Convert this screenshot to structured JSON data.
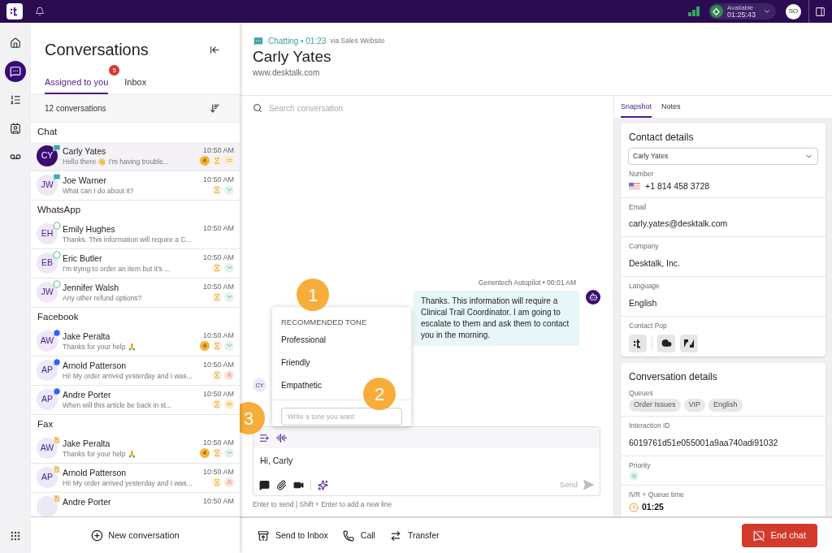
{
  "top_bar": {
    "status_label": "Available",
    "status_timer": "01:25:43",
    "user_initials": "SO"
  },
  "nav_rail": [
    {
      "kind": "home",
      "selected": false
    },
    {
      "kind": "conversations",
      "selected": true
    },
    {
      "kind": "tasks",
      "selected": false
    },
    {
      "kind": "contacts",
      "selected": false
    },
    {
      "kind": "voicemail",
      "selected": false
    }
  ],
  "conversations_panel": {
    "title": "Conversations",
    "tabs": [
      {
        "label": "Assigned to you",
        "badge": "5",
        "selected": true
      },
      {
        "label": "Inbox",
        "selected": false
      }
    ],
    "count": "12 conversations",
    "groups": [
      {
        "title": "Chat",
        "items": [
          {
            "initials": "CY",
            "kind": "chat",
            "name": "Carly Yates",
            "preview": "Hello there 👋 I'm having trouble...",
            "time": "10:50 AM",
            "unread": "4",
            "waiting": true,
            "priority": {
              "kind": "medium"
            },
            "selected": true
          },
          {
            "initials": "JW",
            "kind": "chat",
            "name": "Joe Warner",
            "preview": "What can I do about it?",
            "time": "10:50 AM",
            "waiting": true,
            "priority": {
              "kind": "low"
            },
            "selected": false
          }
        ]
      },
      {
        "title": "WhatsApp",
        "items": [
          {
            "initials": "EH",
            "kind": "whatsapp",
            "name": "Emily Hughes",
            "preview": "Thanks. This information will require a C...",
            "time": "10:50 AM",
            "waiting": false,
            "selected": false
          },
          {
            "initials": "EB",
            "kind": "whatsapp",
            "name": "Eric Butler",
            "preview": "I'm trying to order an item but it's ...",
            "time": "10:50 AM",
            "waiting": true,
            "priority": {
              "kind": "low"
            },
            "selected": false
          },
          {
            "initials": "JW",
            "kind": "whatsapp",
            "name": "Jennifer Walsh",
            "preview": "Any other refund options?",
            "time": "10:50 AM",
            "waiting": true,
            "priority": {
              "kind": "low"
            },
            "selected": false
          }
        ]
      },
      {
        "title": "Facebook",
        "items": [
          {
            "initials": "AW",
            "kind": "messenger",
            "name": "Jake Peralta",
            "preview": "Thanks for your help 🙏",
            "time": "10:50 AM",
            "unread": "4",
            "waiting": true,
            "priority": {
              "kind": "low"
            },
            "selected": false
          },
          {
            "initials": "AP",
            "kind": "messenger",
            "name": "Arnold Patterson",
            "preview": "Hi! My order arrived yesterday and I was...",
            "time": "10:50 AM",
            "waiting": true,
            "priority": {
              "kind": "high"
            },
            "selected": false
          },
          {
            "initials": "AP",
            "kind": "messenger",
            "name": "Andre Porter",
            "preview": "When will this article be back in st...",
            "time": "10:50 AM",
            "waiting": true,
            "priority": {
              "kind": "medium"
            },
            "selected": false
          }
        ]
      },
      {
        "title": "Fax",
        "items": [
          {
            "initials": "AW",
            "kind": "fax",
            "name": "Jake Peralta",
            "preview": "Thanks for your help 🙏",
            "time": "10:50 AM",
            "unread": "4",
            "waiting": true,
            "priority": {
              "kind": "low"
            },
            "selected": false
          },
          {
            "initials": "AP",
            "kind": "fax",
            "name": "Arnold Patterson",
            "preview": "Hi! My order arrived yesterday and I was...",
            "time": "10:50 AM",
            "waiting": true,
            "priority": {
              "kind": "high"
            },
            "selected": false
          },
          {
            "kind": "fax",
            "name": "Andre Porter",
            "time": "10:50 AM",
            "waiting": false,
            "selected": false
          }
        ]
      }
    ],
    "new_button": "New conversation"
  },
  "conversation_header": {
    "status": "Chatting • 01:23",
    "via": "via Sales Website",
    "name": "Carly Yates",
    "website": "www.desktalk.com"
  },
  "chat": {
    "search_placeholder": "Search conversation",
    "messages": [
      {
        "meta": "Genentech Autopilot • 00:01 AM",
        "text": "Thanks. This information will require a Clinical Trail Coordinator. I am going to escalate to them and ask them to contact you in the morning."
      }
    ],
    "customer_initials": "CY"
  },
  "tone_menu": {
    "heading": "RECOMMENDED TONE",
    "options": [
      "Professional",
      "Friendly",
      "Empathetic"
    ],
    "placeholder": "Write a tone you want"
  },
  "callouts": [
    "1",
    "2",
    "3"
  ],
  "composer": {
    "text": "Hi, Carly",
    "send": "Send",
    "hint": "Enter to send | Shift + Enter to add a new line"
  },
  "actions": [
    {
      "kind": "inbox",
      "label": "Send to Inbox"
    },
    {
      "kind": "call",
      "label": "Call"
    },
    {
      "kind": "transfer",
      "label": "Transfer"
    }
  ],
  "end_button": "End chat",
  "side_panel": {
    "tabs": [
      {
        "label": "Snapshot",
        "selected": true
      },
      {
        "label": "Notes",
        "selected": false
      }
    ],
    "contact_details": {
      "title": "Contact details",
      "selected_contact": "Carly Yates",
      "fields": [
        {
          "kind": "phone",
          "label": "Number",
          "value": "+1 814 458 3728"
        },
        {
          "kind": "text",
          "label": "Email",
          "value": "carly.yates@desktalk.com"
        },
        {
          "kind": "text",
          "label": "Company",
          "value": "Desktalk, Inc."
        },
        {
          "kind": "text",
          "label": "Language",
          "value": "English"
        },
        {
          "kind": "pop",
          "label": "Contact Pop"
        }
      ]
    },
    "conversation_details": {
      "title": "Conversation details",
      "fields": [
        {
          "kind": "tags",
          "label": "Queues",
          "tags": [
            "Order Issues",
            "VIP",
            "English"
          ]
        },
        {
          "kind": "text",
          "label": "Interaction ID",
          "value": "6019761d51e055001a9aa740adi91032"
        },
        {
          "kind": "priority",
          "label": "Priority",
          "priority": {
            "kind": "low"
          }
        },
        {
          "kind": "time",
          "label": "IVR + Queue time",
          "value": "01:25"
        }
      ]
    }
  }
}
